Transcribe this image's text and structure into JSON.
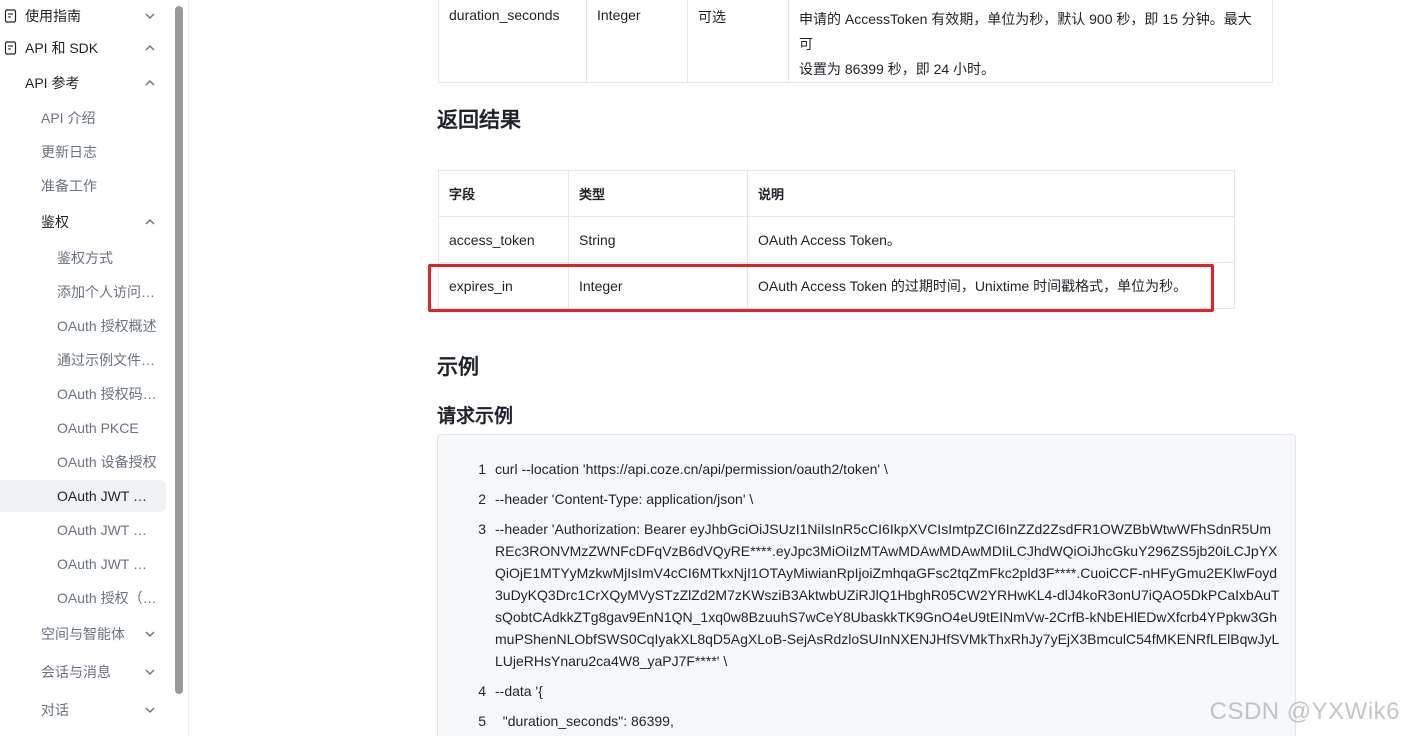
{
  "sidebar": {
    "items": [
      {
        "label": "使用指南",
        "expanded": false
      },
      {
        "label": "API 和 SDK",
        "expanded": true
      },
      {
        "label": "API 参考",
        "expanded": true
      },
      {
        "label": "API 介绍"
      },
      {
        "label": "更新日志"
      },
      {
        "label": "准备工作"
      },
      {
        "label": "鉴权",
        "expanded": true
      },
      {
        "label": "鉴权方式"
      },
      {
        "label": "添加个人访问…"
      },
      {
        "label": "OAuth 授权概述"
      },
      {
        "label": "通过示例文件…"
      },
      {
        "label": "OAuth 授权码…"
      },
      {
        "label": "OAuth PKCE"
      },
      {
        "label": "OAuth 设备授权"
      },
      {
        "label": "OAuth JWT …",
        "active": true
      },
      {
        "label": "OAuth JWT …"
      },
      {
        "label": "OAuth JWT …"
      },
      {
        "label": "OAuth 授权（…"
      },
      {
        "label": "空间与智能体",
        "expanded": false
      },
      {
        "label": "会话与消息",
        "expanded": false
      },
      {
        "label": "对话",
        "expanded": false
      }
    ]
  },
  "request_table": {
    "row": {
      "name": "duration_seconds",
      "type": "Integer",
      "required": "可选",
      "desc_line1": "申请的 AccessToken 有效期，单位为秒，默认 900 秒，即 15 分钟。最大可",
      "desc_line2": "设置为 86399 秒，即 24 小时。"
    }
  },
  "response_section": {
    "title": "返回结果",
    "headers": {
      "field": "字段",
      "type": "类型",
      "desc": "说明"
    },
    "rows": [
      {
        "field": "access_token",
        "type": "String",
        "desc": "OAuth Access Token。"
      },
      {
        "field": "expires_in",
        "type": "Integer",
        "desc": "OAuth Access Token 的过期时间，Unixtime 时间戳格式，单位为秒。"
      }
    ]
  },
  "example_section": {
    "title": "示例",
    "subtitle": "请求示例",
    "lines": [
      {
        "n": "1",
        "text": "curl --location 'https://api.coze.cn/api/permission/oauth2/token' \\"
      },
      {
        "n": "2",
        "text": "--header 'Content-Type: application/json' \\"
      },
      {
        "n": "3",
        "text": "--header 'Authorization: Bearer eyJhbGciOiJSUzI1NiIsInR5cCI6IkpXVCIsImtpZCI6InZZd2ZsdFR1OWZBbWtwWFhSdnR5UmREc3RONVMzZWNFcDFqVzB6dVQyRE****.eyJpc3MiOiIzMTAwMDAwMDAwMDIiLCJhdWQiOiJhcGkuY296ZS5jb20iLCJpYXQiOjE1MTYyMzkwMjIsImV4cCI6MTkxNjI1OTAyMiwianRpIjoiZmhqaGFsc2tqZmFkc2pld3F****.CuoiCCF-nHFyGmu2EKlwFoyd3uDyKQ3Drc1CrXQyMVySTzZlZd2M7zKWsziB3AktwbUZiRJlQ1HbghR05CW2YRHwKL4-dlJ4koR3onU7iQAO5DkPCaIxbAuTsQobtCAdkkZTg8gav9EnN1QN_1xq0w8BzuuhS7wCeY8UbaskkTK9GnO4eU9tEINmVw-2CrfB-kNbEHlEDwXfcrb4YPpkw3GhmuPShenNLObfSWS0CqIyakXL8qD5AgXLoB-SejAsRdzloSUInNXENJHfSVMkThxRhJy7yEjX3BmculC54fMKENRfLElBqwJyLLUjeRHsYnaru2ca4W8_yaPJ7F****' \\"
      },
      {
        "n": "4",
        "text": "--data '{"
      },
      {
        "n": "5",
        "text": "  \"duration_seconds\": 86399,"
      }
    ]
  },
  "watermark": "CSDN @YXWik6"
}
